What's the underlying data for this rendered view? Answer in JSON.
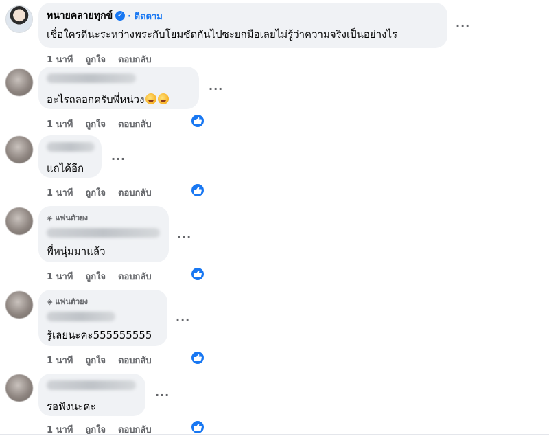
{
  "main_comment": {
    "author": "ทนายคลายทุกข์",
    "follow_label": "· ติดตาม",
    "text": "เชื่อใครดีนะระหว่างพระกับโยมซัดกันไปซะยกมือเลยไม่รู้ว่าความจริงเป็นอย่างไร",
    "time": "1 นาที",
    "like_label": "ถูกใจ",
    "reply_label": "ตอบกลับ"
  },
  "replies": [
    {
      "text": "อะไรถลอกครับพี่หน่วง",
      "fan_badge": "",
      "time": "1 นาที",
      "like_label": "ถูกใจ",
      "reply_label": "ตอบกลับ",
      "has_reaction": true
    },
    {
      "text": "แถได้อีก",
      "fan_badge": "",
      "time": "1 นาที",
      "like_label": "ถูกใจ",
      "reply_label": "ตอบกลับ",
      "has_reaction": true
    },
    {
      "text": "พี่หนุ่มมาแล้ว",
      "fan_badge": "แฟนตัวยง",
      "time": "1 นาที",
      "like_label": "ถูกใจ",
      "reply_label": "ตอบกลับ",
      "has_reaction": true
    },
    {
      "text": "รู้เลยนะคะ555555555",
      "fan_badge": "แฟนตัวยง",
      "time": "1 นาที",
      "like_label": "ถูกใจ",
      "reply_label": "ตอบกลับ",
      "has_reaction": true
    },
    {
      "text": "รอฟังนะคะ",
      "fan_badge": "",
      "time": "1 นาที",
      "like_label": "ถูกใจ",
      "reply_label": "ตอบกลับ",
      "has_reaction": true
    }
  ],
  "icons": {
    "more": "more-options-icon",
    "verified": "verified-badge-icon",
    "reaction": "like-thumb-icon",
    "diamond": "diamond-icon"
  },
  "colors": {
    "accent": "#1877f2",
    "bubble": "#f0f2f5",
    "meta": "#65676b"
  }
}
